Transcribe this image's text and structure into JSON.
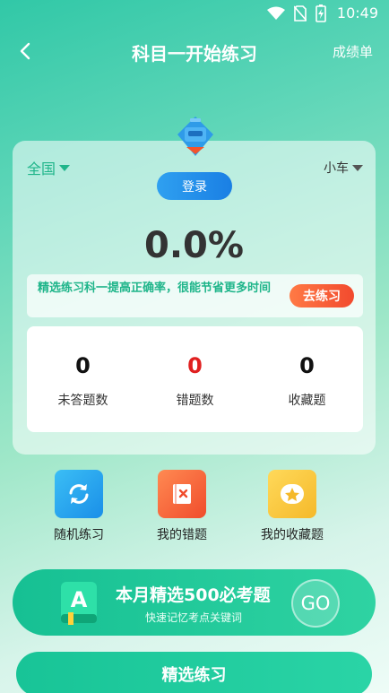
{
  "status_bar": {
    "time": "10:49"
  },
  "nav": {
    "title": "科目一开始练习",
    "right_label": "成绩单"
  },
  "card": {
    "region": "全国",
    "vehicle": "小车",
    "login_label": "登录",
    "accuracy": "0.0%",
    "tip_text": "精选练习科一提高正确率，很能节省更多时间",
    "tip_button": "去练习",
    "stats": [
      {
        "value": "0",
        "label": "未答题数"
      },
      {
        "value": "0",
        "label": "错题数"
      },
      {
        "value": "0",
        "label": "收藏题"
      }
    ]
  },
  "quick_actions": [
    {
      "label": "随机练习",
      "icon": "refresh-icon"
    },
    {
      "label": "我的错题",
      "icon": "wrong-book-icon"
    },
    {
      "label": "我的收藏题",
      "icon": "star-icon"
    }
  ],
  "banner": {
    "title": "本月精选500必考题",
    "subtitle": "快速记忆考点关键词",
    "go_label": "GO",
    "icon": "book-a-icon"
  },
  "bottom_button": "精选练习",
  "colors": {
    "accent": "#1fb58a",
    "login": "#1a7fe4",
    "tip_button": "#f24a2e",
    "error": "#e02020"
  }
}
